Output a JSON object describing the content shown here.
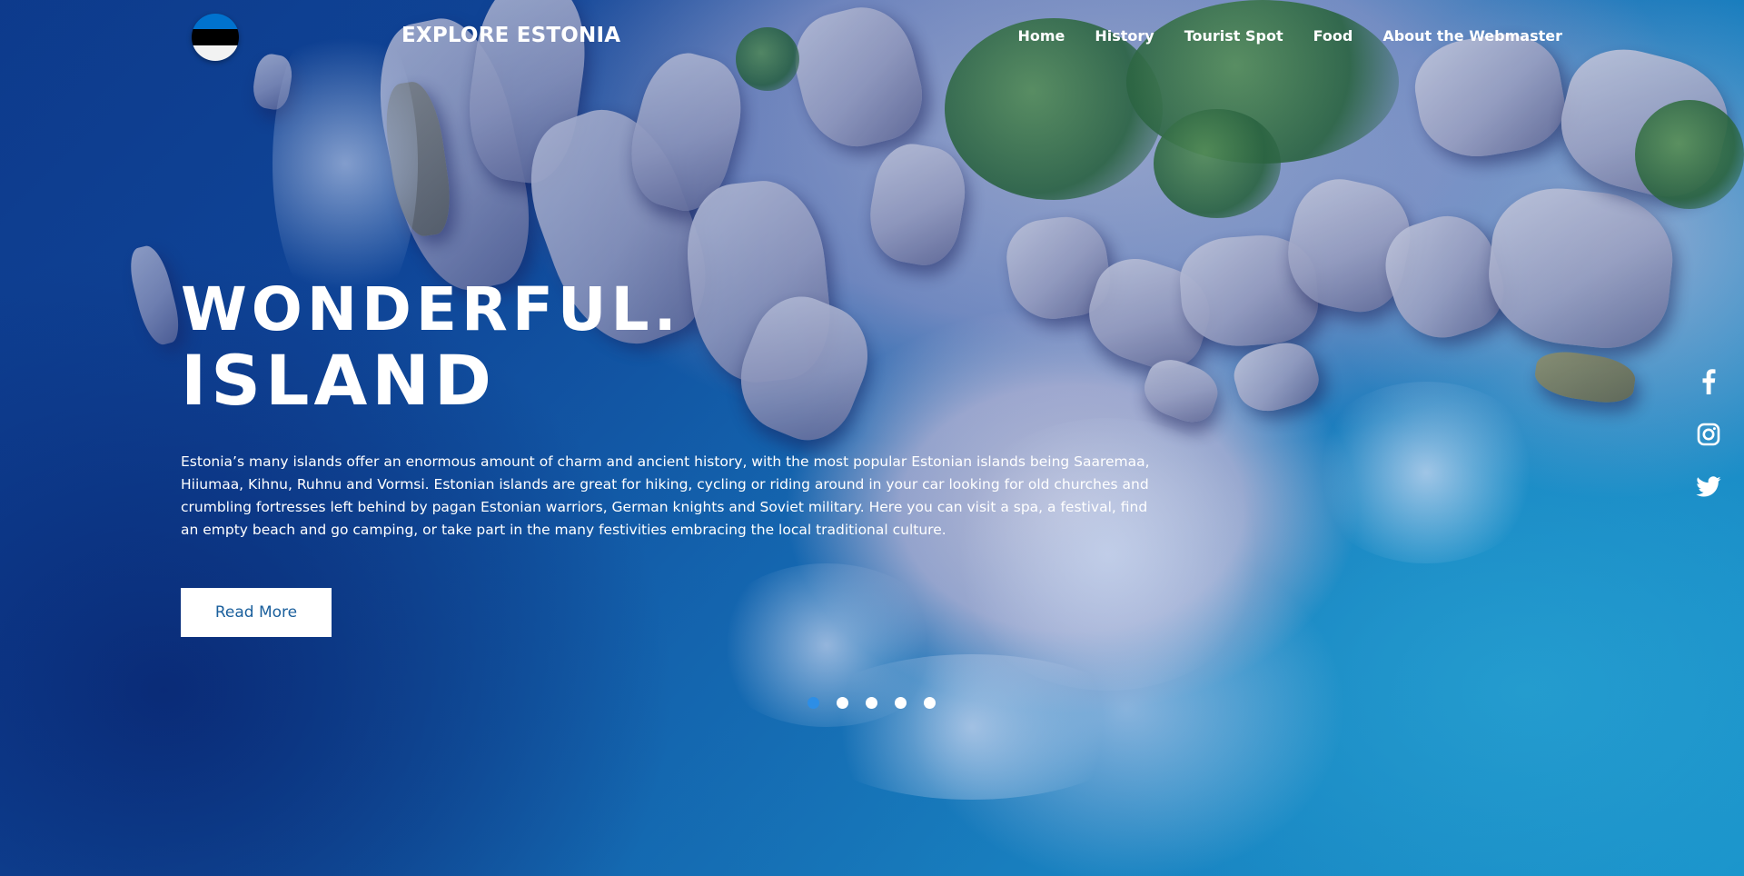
{
  "nav": {
    "brand": "EXPLORE ESTONIA",
    "flag_colors": [
      "#0072ce",
      "#000000",
      "#ffffff"
    ],
    "links": [
      {
        "label": "Home"
      },
      {
        "label": "History"
      },
      {
        "label": "Tourist Spot"
      },
      {
        "label": "Food"
      },
      {
        "label": "About the Webmaster"
      }
    ]
  },
  "hero": {
    "title_line1": "WONDERFUL.",
    "title_line2": "ISLAND",
    "description": "Estonia’s many islands offer an enormous amount of charm and ancient history, with the most popular Estonian islands being Saaremaa, Hiiumaa, Kihnu, Ruhnu and Vormsi. Estonian islands are great for hiking, cycling or riding around in your car looking for old churches and crumbling fortresses left behind by pagan Estonian warriors, German knights and Soviet military. Here you can visit a spa, a festival, find an empty beach and go camping, or take part in the many festivities embracing the local traditional culture.",
    "button_label": "Read More"
  },
  "slider": {
    "count": 5,
    "active_index": 0,
    "active_color": "#2d8ee6"
  },
  "social": {
    "icons": [
      "facebook-icon",
      "instagram-icon",
      "twitter-icon"
    ]
  }
}
